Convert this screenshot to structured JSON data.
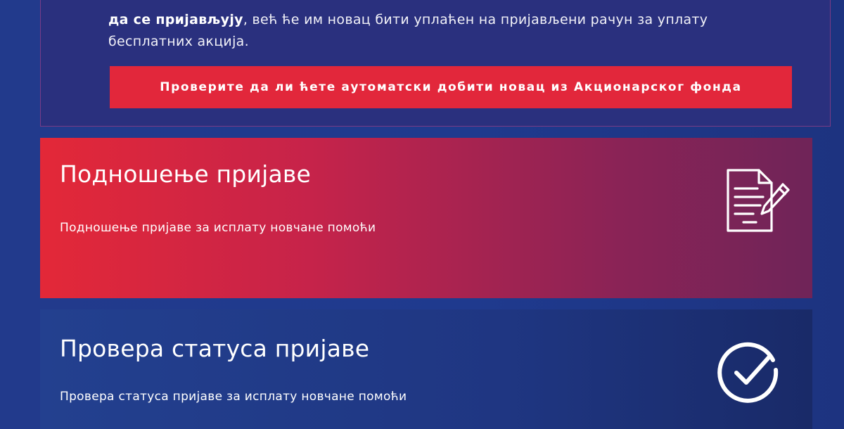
{
  "notice": {
    "line1_bold": "да се пријављују",
    "line1_rest": ", већ ће им новац бити уплаћен на пријављени рачун за уплату",
    "line2": "бесплатних акција.",
    "button_label": "Проверите да ли ћете аутоматски добити новац из Акционарског фонда"
  },
  "cards": {
    "submit": {
      "title": "Подношење пријаве",
      "description": "Подношење пријаве за исплату новчане помоћи",
      "icon": "document-sign-icon"
    },
    "status": {
      "title": "Провера статуса пријаве",
      "description": "Провера статуса пријаве за исплату новчане помоћи",
      "icon": "check-circle-icon"
    }
  },
  "colors": {
    "background": "#1f3a8e",
    "notice_panel": "#2a307e",
    "button": "#e2273b",
    "card_submit_start": "#e32838",
    "card_submit_end": "#6f2458",
    "card_status": "#23408f"
  }
}
